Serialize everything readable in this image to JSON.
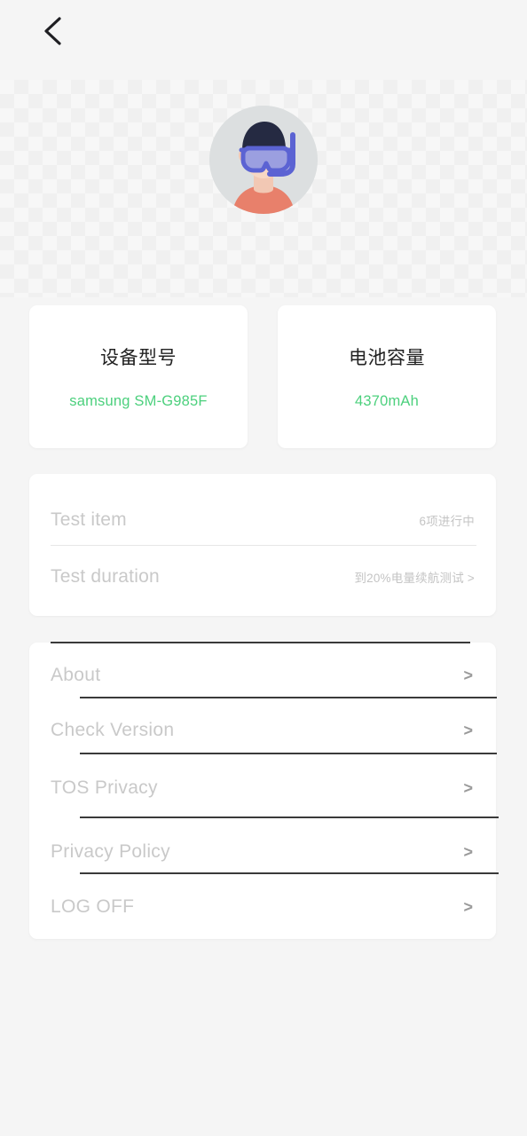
{
  "navbar": {
    "back_icon": "chevron-left-icon"
  },
  "profile": {
    "avatar_icon": "diver-avatar"
  },
  "device_cards": [
    {
      "title": "设备型号",
      "value": "samsung SM-G985F"
    },
    {
      "title": "电池容量",
      "value": "4370mAh"
    }
  ],
  "test_panel": {
    "rows": [
      {
        "label": "Test item",
        "value": "6项进行中"
      },
      {
        "label": "Test duration",
        "value": "到20%电量续航测试 >"
      }
    ]
  },
  "menu": {
    "items": [
      {
        "label": "About",
        "chevron": ">"
      },
      {
        "label": "Check Version",
        "chevron": ">"
      },
      {
        "label": "TOS Privacy",
        "chevron": ">"
      },
      {
        "label": "Privacy Policy",
        "chevron": ">"
      },
      {
        "label": "LOG OFF",
        "chevron": ">"
      }
    ]
  },
  "colors": {
    "accent_green": "#4cd07d",
    "background": "#f5f5f5",
    "card": "#ffffff",
    "muted_text": "#c9c9c9",
    "divider_dark": "#3a3a3a"
  }
}
